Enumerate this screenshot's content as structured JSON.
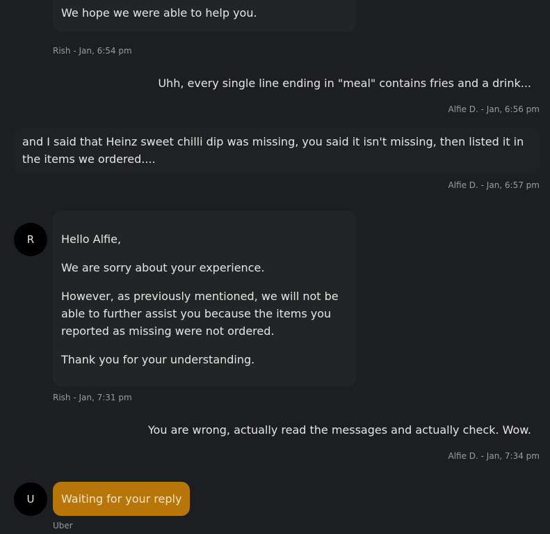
{
  "messages": {
    "m1": {
      "text": "We hope we were able to help you.",
      "meta": "Rish - Jan, 6:54 pm"
    },
    "m2": {
      "text": "Uhh, every single line ending in \"meal\" contains fries and a drink...",
      "meta": "Alfie D. - Jan, 6:56 pm"
    },
    "m3": {
      "text": "and I said that Heinz sweet chilli dip was missing, you said it isn't missing, then listed it in the items we ordered....",
      "meta": "Alfie D. - Jan, 6:57 pm"
    },
    "m4": {
      "avatar": "R",
      "paragraphs": [
        "Hello Alfie,",
        "We are sorry about your experience.",
        "However, as previously mentioned, we will not be able to further assist you because the items you reported as missing were not ordered.",
        "Thank you for your understanding."
      ],
      "meta": "Rish - Jan, 7:31 pm"
    },
    "m5": {
      "text": "You are wrong, actually read the messages and actually check. Wow.",
      "meta": "Alfie D. - Jan, 7:34 pm"
    },
    "m6": {
      "avatar": "U",
      "status": "Waiting for your reply",
      "meta": "Uber"
    }
  },
  "colors": {
    "background": "#1c1e21",
    "agent_bubble": "#222526",
    "status_pill": "#b8760a",
    "avatar": "#000000"
  }
}
